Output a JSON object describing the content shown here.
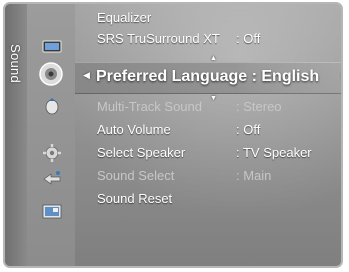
{
  "tab_label": "Sound",
  "icons": [
    "picture-icon",
    "sound-icon",
    "channel-icon",
    "setup-icon",
    "input-icon",
    "application-icon"
  ],
  "items": [
    {
      "label": "Equalizer",
      "value": "",
      "dim": false
    },
    {
      "label": "SRS TruSurround XT",
      "value": ": Off",
      "dim": false
    },
    {
      "label": "Multi-Track Sound",
      "value": ": Stereo",
      "dim": true
    },
    {
      "label": "Auto Volume",
      "value": ": Off",
      "dim": false
    },
    {
      "label": "Select Speaker",
      "value": ": TV Speaker",
      "dim": false
    },
    {
      "label": "Sound Select",
      "value": ": Main",
      "dim": true
    },
    {
      "label": "Sound Reset",
      "value": "",
      "dim": false
    }
  ],
  "selected": {
    "label": "Preferred Language",
    "value": ": English"
  }
}
